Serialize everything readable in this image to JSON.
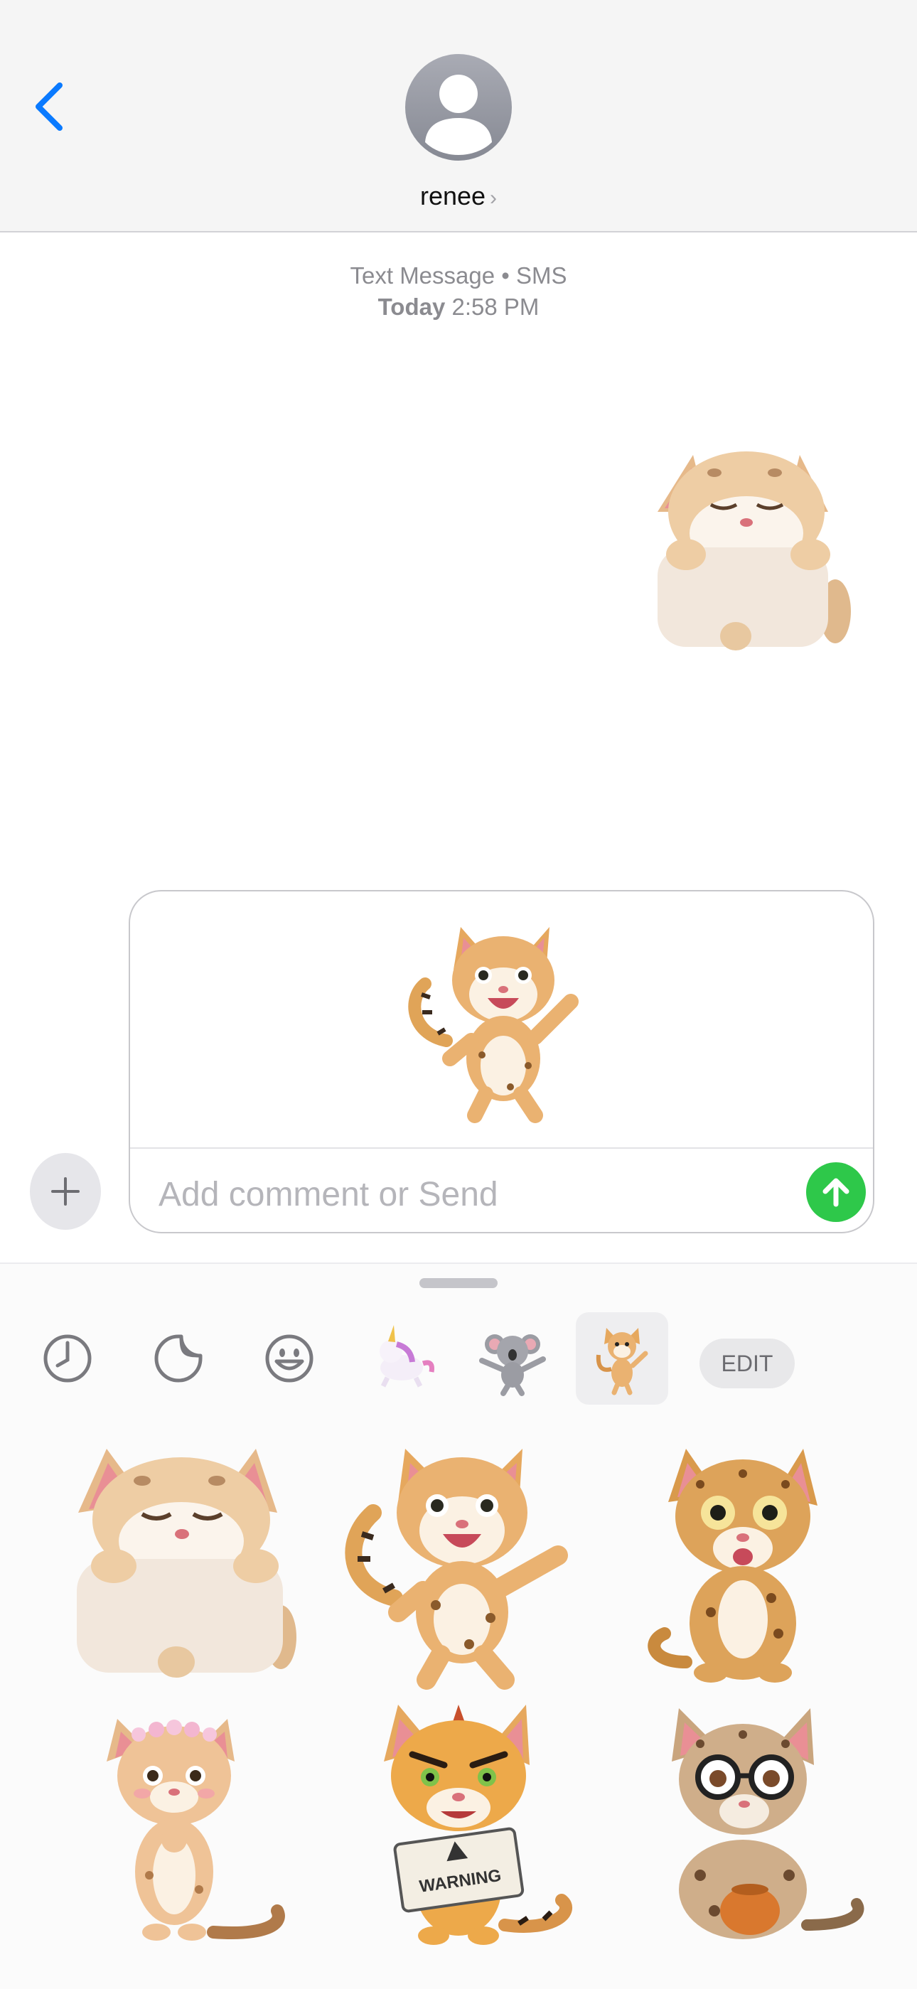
{
  "header": {
    "contact_name": "renee",
    "chevron": "›",
    "back_icon": "chevron-left-icon"
  },
  "meta": {
    "service": "Text Message • SMS",
    "date_prefix": "Today",
    "time": "2:58 PM"
  },
  "compose": {
    "placeholder": "Add comment or Send"
  },
  "drawer": {
    "tabs": [
      {
        "icon": "recents-clock-icon"
      },
      {
        "icon": "sticker-peel-icon"
      },
      {
        "icon": "emoji-smiley-icon"
      },
      {
        "icon": "unicorn-sticker-pack-icon"
      },
      {
        "icon": "koala-sticker-pack-icon"
      },
      {
        "icon": "ocelot-sticker-pack-icon",
        "selected": true
      }
    ],
    "edit_label": "EDIT",
    "stickers": [
      {
        "name": "sleepy-ocelot-pillow"
      },
      {
        "name": "happy-ocelot-dancing"
      },
      {
        "name": "surprised-ocelot"
      },
      {
        "name": "ocelot-flower-crown"
      },
      {
        "name": "angry-ocelot-warning-sign"
      },
      {
        "name": "ocelot-glasses-pot"
      }
    ],
    "warning_sign_text": "WARNING"
  },
  "colors": {
    "ios_blue": "#0a7aff",
    "send_green": "#2ec84a",
    "fur": "#e6b98a",
    "ear_pink": "#e98f95"
  }
}
